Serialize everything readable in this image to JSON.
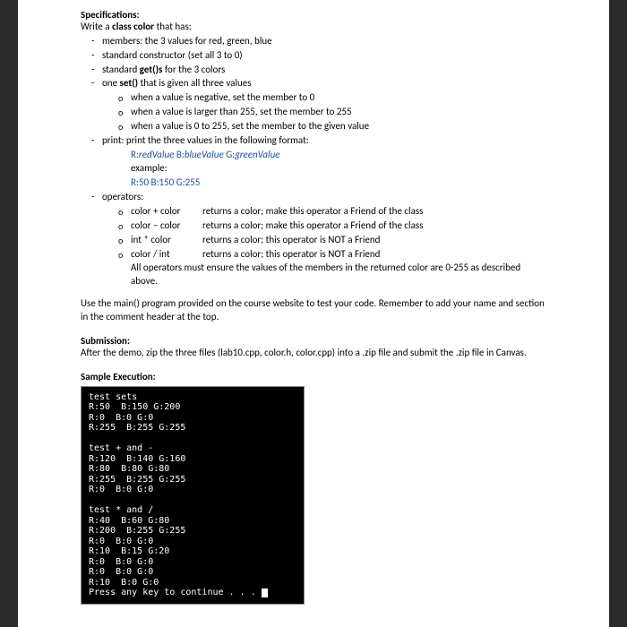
{
  "spec": {
    "heading": "Specifications:",
    "intro_prefix": "Write a ",
    "intro_bold": "class color",
    "intro_suffix": " that has:",
    "b1": "members: the 3 values for red, green, blue",
    "b2": "standard constructor (set all 3 to 0)",
    "b3_a": "standard ",
    "b3_b": "get()s",
    "b3_c": " for the 3 colors",
    "b4_a": "one ",
    "b4_b": "set()",
    "b4_c": " that is given all three values",
    "b4_s1": "when a value is negative, set the member to 0",
    "b4_s2": "when a value is larger than 255, set the member to 255",
    "b4_s3": "when a value is 0 to 255, set the member to the given value",
    "b5": "print: print the three values in the following format:",
    "b5_fmt_r": "R:",
    "b5_fmt_rv": "redValue",
    "b5_fmt_b": "  B:",
    "b5_fmt_bv": "blueValue",
    "b5_fmt_g": "  G:",
    "b5_fmt_gv": "greenValue",
    "b5_ex": "example:",
    "b5_ex_val": "R:50  B:150  G:255",
    "b6": "operators:",
    "op1_l": "color + color",
    "op1_r": "returns a color; make this operator a Friend of the class",
    "op2_l": "color – color",
    "op2_r": "returns a color; make this operator a Friend of the class",
    "op3_l": "int  *  color",
    "op3_r": "returns a color; this operator is NOT a Friend",
    "op4_l": "color  /  int",
    "op4_r": "returns a color; this operator is NOT a Friend",
    "op_note": "All operators must ensure the values of the members in the returned color are 0-255 as described above.",
    "use_main": "Use the main() program provided on the course website to test your code. Remember to add your name and section in the comment header at the top."
  },
  "submission": {
    "heading": "Submission:",
    "text": "After the demo, zip the three files (lab10.cpp, color.h, color.cpp) into a .zip file and submit the .zip file in Canvas."
  },
  "sample": {
    "heading": "Sample Execution:",
    "lines": "test sets\nR:50  B:150 G:200\nR:0  B:0 G:0\nR:255  B:255 G:255\n\ntest + and -\nR:120  B:140 G:160\nR:80  B:80 G:80\nR:255  B:255 G:255\nR:0  B:0 G:0\n\ntest * and /\nR:40  B:60 G:80\nR:200  B:255 G:255\nR:0  B:0 G:0\nR:10  B:15 G:20\nR:0  B:0 G:0\nR:0  B:0 G:0\nR:10  B:0 G:0\nPress any key to continue . . . "
  }
}
